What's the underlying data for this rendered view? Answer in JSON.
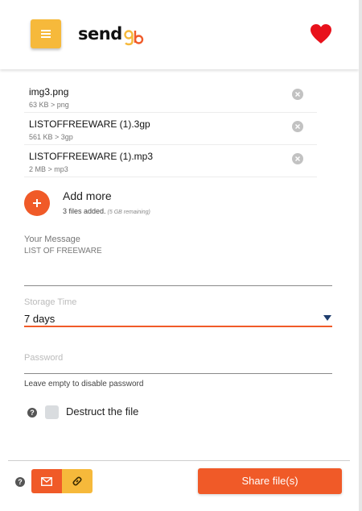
{
  "header": {
    "logo_text": "send",
    "logo_suffix": "gb",
    "menu_icon": "hamburger-icon",
    "favorite_icon": "heart-icon",
    "accent": "#f6b93b",
    "heart_color": "#e8111b"
  },
  "files": [
    {
      "name": "img3.png",
      "meta": "63 KB > png"
    },
    {
      "name": "LISTOFFREEWARE (1).3gp",
      "meta": "561 KB > 3gp"
    },
    {
      "name": "LISTOFFREEWARE (1).mp3",
      "meta": "2 MB > mp3"
    }
  ],
  "add_more": {
    "label": "Add more",
    "count_text": "3 files added.",
    "remaining_text": "(5 GB remaining)"
  },
  "message": {
    "label": "Your Message",
    "value": "LIST OF FREEWARE"
  },
  "storage": {
    "label": "Storage Time",
    "value": "7 days"
  },
  "password": {
    "placeholder": "Password",
    "help": "Leave empty to disable password"
  },
  "destruct": {
    "label": "Destruct the file",
    "checked": false
  },
  "footer": {
    "share_label": "Share file(s)",
    "mode_email_icon": "envelope-icon",
    "mode_link_icon": "link-icon",
    "brand_color": "#f05a28"
  }
}
